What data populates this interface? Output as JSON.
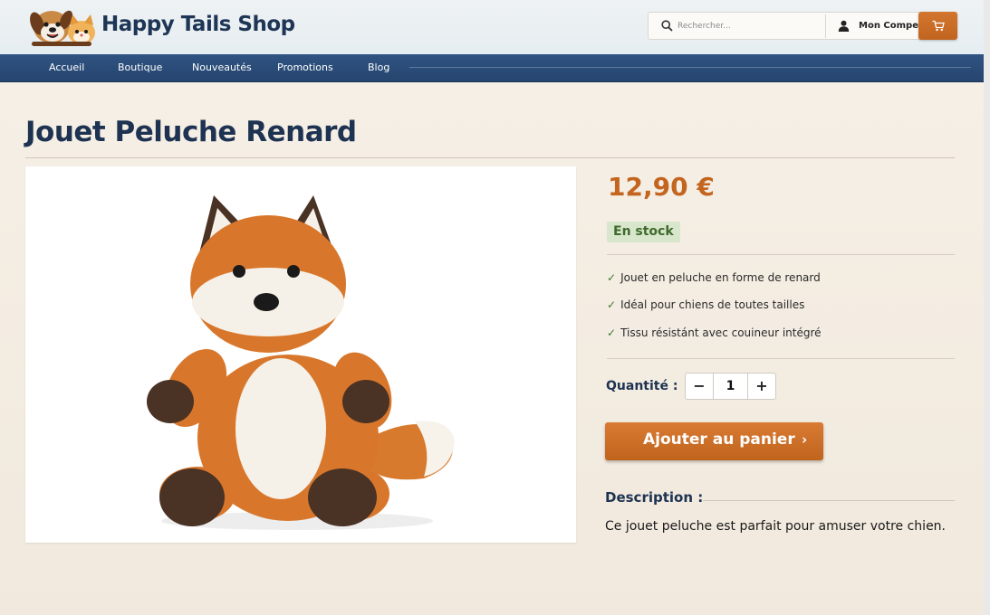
{
  "brand": {
    "name": "Happy Tails Shop",
    "logo_icon": "dog-cat-logo-icon"
  },
  "search": {
    "placeholder": "Rechercher..."
  },
  "account": {
    "label": "Mon Compe"
  },
  "cart": {
    "icon": "cart-icon"
  },
  "nav": {
    "items": [
      {
        "label": "Accueil"
      },
      {
        "label": "Boutique"
      },
      {
        "label": "Nouveautés"
      },
      {
        "label": "Promotions"
      },
      {
        "label": "Blog"
      }
    ]
  },
  "product": {
    "title": "Jouet Peluche Renard",
    "price": "12,90 €",
    "stock": "En stock",
    "features": [
      "Jouet en peluche en forme de renard",
      "Idéal pour chiens de toutes tailles",
      "Tissu résistánt avec couineur intégré"
    ],
    "quantity_label": "Quantité :",
    "quantity": "1",
    "add_to_cart": "Ajouter au panier",
    "description_title": "Description :",
    "description": "Ce jouet peluche est parfait pour amuser votre chien."
  },
  "colors": {
    "accent": "#c4651f",
    "nav_bg": "#2b4c79",
    "title": "#1e3352",
    "stock_bg": "#d8e6cc",
    "stock_text": "#3f6a2c"
  }
}
